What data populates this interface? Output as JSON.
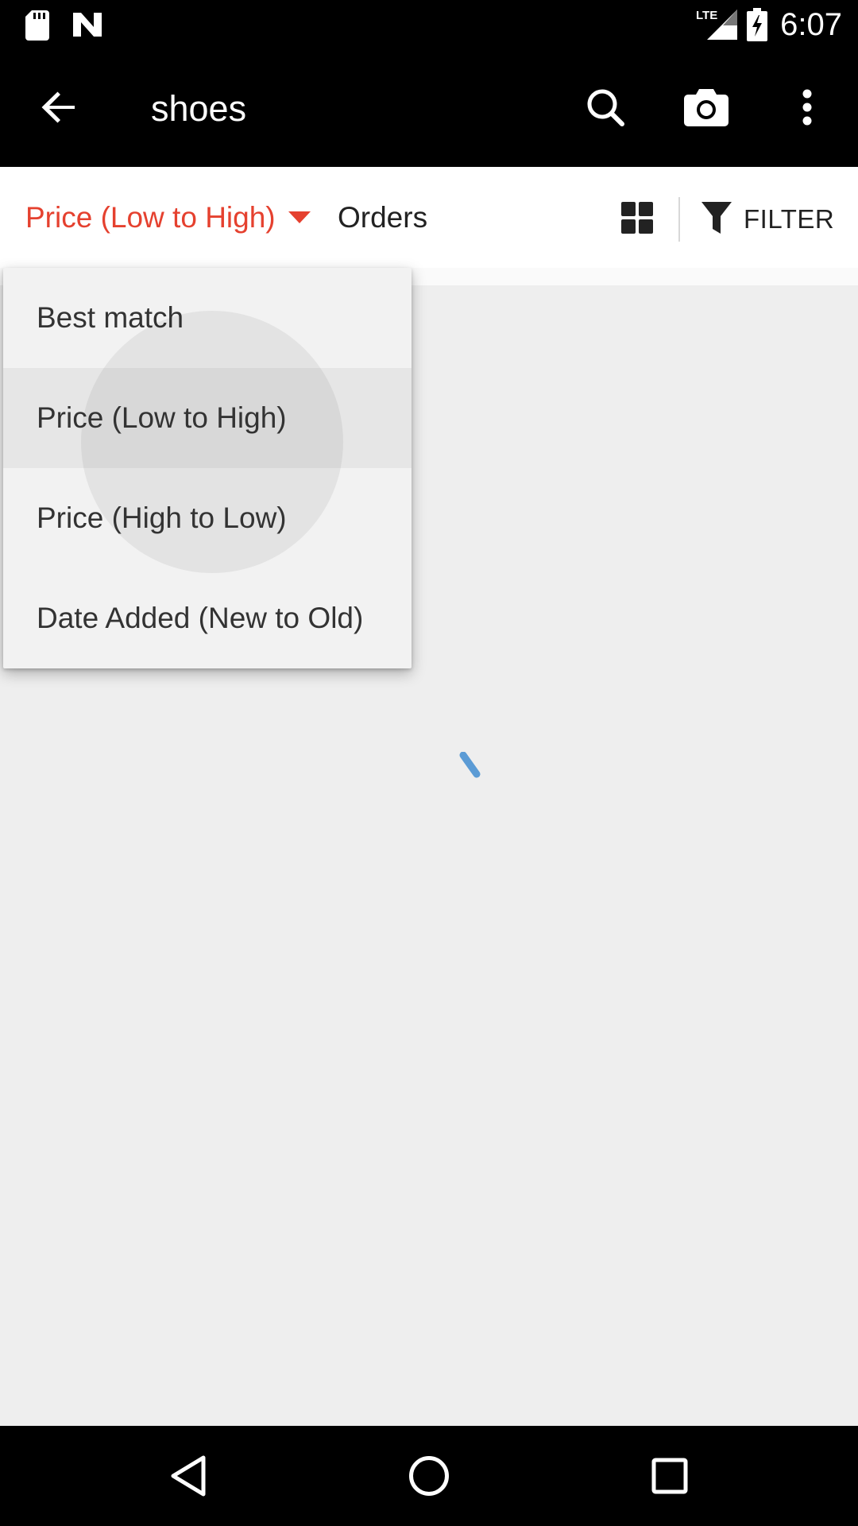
{
  "status_bar": {
    "time": "6:07",
    "network_label": "LTE",
    "icons": [
      "sd-card-icon",
      "n-logo-icon",
      "lte-signal-icon",
      "battery-charging-icon"
    ]
  },
  "toolbar": {
    "title": "shoes",
    "icons": [
      "back-arrow-icon",
      "search-icon",
      "camera-icon",
      "more-vert-icon"
    ]
  },
  "sort_bar": {
    "current_sort": "Price (Low to High)",
    "orders_label": "Orders",
    "filter_label": "FILTER",
    "accent_color": "#e5412f"
  },
  "sort_menu": {
    "items": [
      {
        "label": "Best match",
        "selected": false
      },
      {
        "label": "Price (Low to High)",
        "selected": true
      },
      {
        "label": "Price (High to Low)",
        "selected": false
      },
      {
        "label": "Date Added (New to Old)",
        "selected": false
      }
    ]
  },
  "loading": {
    "spinner_color": "#5b9bd5"
  },
  "nav_bar": {
    "icons": [
      "back-triangle-icon",
      "home-circle-icon",
      "recents-square-icon"
    ]
  }
}
